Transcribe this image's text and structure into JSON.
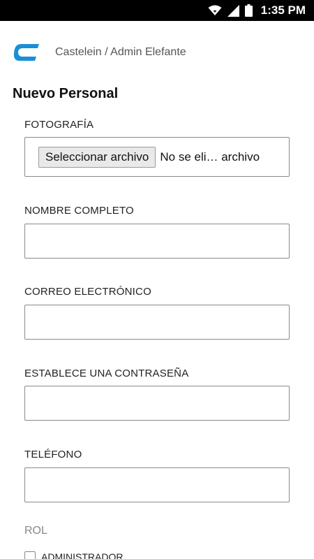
{
  "status_bar": {
    "time": "1:35 PM",
    "icons": [
      "wifi-icon",
      "signal-icon",
      "battery-icon"
    ]
  },
  "header": {
    "logo": "castelein-logo",
    "breadcrumb": "Castelein / Admin Elefante"
  },
  "page": {
    "title": "Nuevo Personal"
  },
  "form": {
    "photo": {
      "label": "FOTOGRAFÍA",
      "button_label": "Seleccionar archivo",
      "file_status": "No se eli… archivo"
    },
    "full_name": {
      "label": "NOMBRE COMPLETO",
      "value": ""
    },
    "email": {
      "label": "CORREO ELECTRÓNICO",
      "value": ""
    },
    "password": {
      "label": "ESTABLECE UNA CONTRASEÑA",
      "value": ""
    },
    "phone": {
      "label": "TELÉFONO",
      "value": ""
    },
    "role": {
      "label": "ROL",
      "options": [
        {
          "label": "ADMINISTRADOR",
          "checked": false
        }
      ]
    }
  },
  "colors": {
    "status_bar_bg": "#000000",
    "logo_blue": "#1a8fd8",
    "border": "#8a8a8a"
  }
}
